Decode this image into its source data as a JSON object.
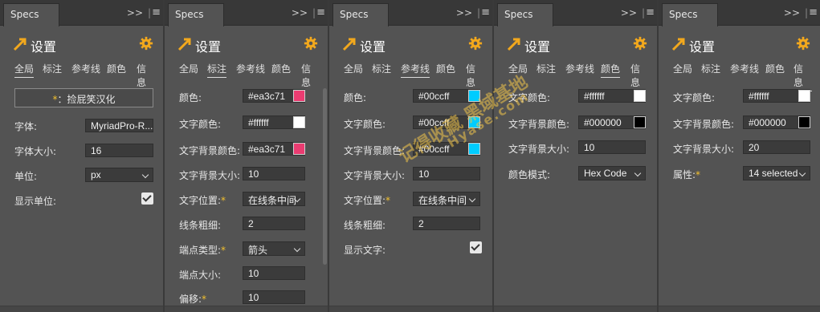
{
  "colors": {
    "accent": "#f2a81d",
    "pink": "#ea3c71",
    "cyan": "#00ccff",
    "white": "#ffffff",
    "black": "#000000"
  },
  "panel_title": "Specs",
  "header_title": "设置",
  "tabs": [
    "全局",
    "标注",
    "参考线",
    "颜色",
    "信息"
  ],
  "toolbar": {
    "expand": ">>",
    "sep": "|",
    "menu": "≡"
  },
  "watermark": {
    "line1": "记得收藏 黑域基地",
    "line2": "Hyase.com"
  },
  "panel1": {
    "active_tab": "全局",
    "button_label": "：捡屁笑汉化",
    "button_star": "*",
    "font_label": "字体:",
    "font_value": "MyriadPro-R...",
    "size_label": "字体大小:",
    "size_value": "16",
    "unit_label": "单位:",
    "unit_value": "px",
    "show_unit_label": "显示单位:"
  },
  "panel2": {
    "active_tab": "标注",
    "color_label": "颜色:",
    "color_value": "#ea3c71",
    "text_color_label": "文字颜色:",
    "text_color_value": "#ffffff",
    "text_bg_color_label": "文字背景颜色:",
    "text_bg_color_value": "#ea3c71",
    "text_bg_size_label": "文字背景大小:",
    "text_bg_size_value": "10",
    "text_pos_label": "文字位置:",
    "text_pos_value": "在线条中间",
    "line_width_label": "线条粗细:",
    "line_width_value": "2",
    "endpoint_type_label": "端点类型:",
    "endpoint_type_value": "箭头",
    "endpoint_size_label": "端点大小:",
    "endpoint_size_value": "10",
    "offset_label": "偏移:",
    "offset_value": "10"
  },
  "panel3": {
    "active_tab": "参考线",
    "color_label": "颜色:",
    "color_value": "#00ccff",
    "text_color_label": "文字颜色:",
    "text_color_value": "#00ccff",
    "text_bg_color_label": "文字背景颜色:",
    "text_bg_color_value": "#00ccff",
    "text_bg_size_label": "文字背景大小:",
    "text_bg_size_value": "10",
    "text_pos_label": "文字位置:",
    "text_pos_value": "在线条中间",
    "line_width_label": "线条粗细:",
    "line_width_value": "2",
    "show_text_label": "显示文字:"
  },
  "panel4": {
    "active_tab": "颜色",
    "text_color_label": "文字颜色:",
    "text_color_value": "#ffffff",
    "text_bg_color_label": "文字背景颜色:",
    "text_bg_color_value": "#000000",
    "text_bg_size_label": "文字背景大小:",
    "text_bg_size_value": "10",
    "color_mode_label": "颜色模式:",
    "color_mode_value": "Hex Code"
  },
  "panel5": {
    "active_tab": "信息",
    "text_color_label": "文字颜色:",
    "text_color_value": "#ffffff",
    "text_bg_color_label": "文字背景颜色:",
    "text_bg_color_value": "#000000",
    "text_bg_size_label": "文字背景大小:",
    "text_bg_size_value": "20",
    "attr_label": "属性:",
    "attr_value": "14 selected"
  }
}
